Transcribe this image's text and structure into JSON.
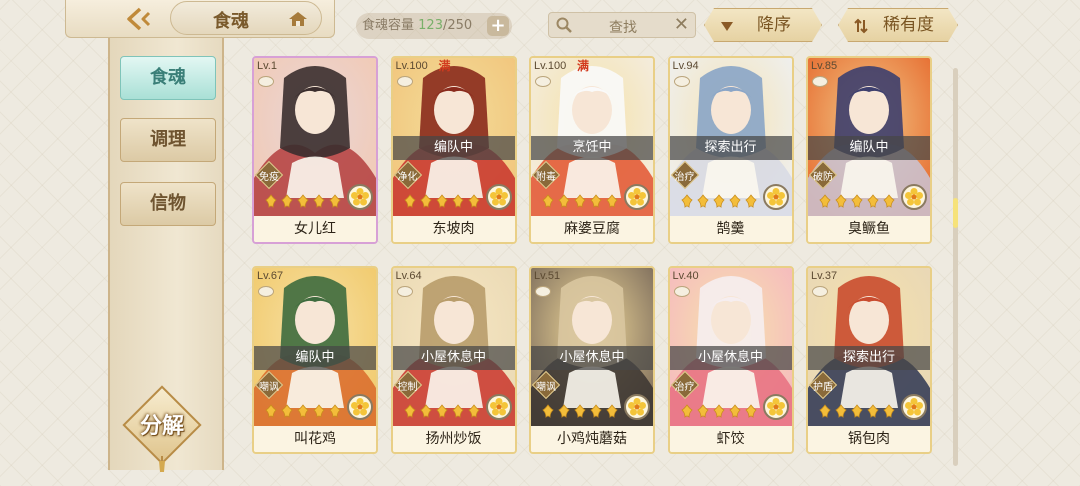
{
  "header": {
    "tab_label": "食魂",
    "capacity_label": "食魂容量",
    "capacity_current": "123",
    "capacity_sep_max": "/250",
    "search_placeholder": "查找",
    "sort_desc_label": "降序",
    "sort_rarity_label": "稀有度"
  },
  "sidebar": {
    "items": [
      {
        "label": "食魂",
        "active": true
      },
      {
        "label": "调理",
        "active": false
      },
      {
        "label": "信物",
        "active": false
      }
    ],
    "decompose_label": "分解"
  },
  "cards": [
    {
      "level": "Lv.1",
      "man": "",
      "status": "",
      "role": "免疫",
      "stars": 5,
      "name": "女儿红",
      "palette": [
        "#e9d6d6",
        "#f2c9b3",
        "#b33d3d",
        "#3a2d2d"
      ],
      "rainbow": true
    },
    {
      "level": "Lv.100",
      "man": "满",
      "status": "编队中",
      "role": "净化",
      "stars": 5,
      "name": "东坡肉",
      "palette": [
        "#f4dd9a",
        "#f1c47b",
        "#c8332b",
        "#8a2a1c"
      ],
      "rainbow": false
    },
    {
      "level": "Lv.100",
      "man": "满",
      "status": "烹饪中",
      "role": "附毒",
      "stars": 5,
      "name": "麻婆豆腐",
      "palette": [
        "#f6e2a8",
        "#f3ede2",
        "#e2542f",
        "#fafafa"
      ],
      "rainbow": false
    },
    {
      "level": "Lv.94",
      "man": "",
      "status": "探索出行",
      "role": "治疗",
      "stars": 5,
      "name": "鹄羹",
      "palette": [
        "#f5e4b6",
        "#eef0f3",
        "#d7d9e4",
        "#8aa5c7"
      ],
      "rainbow": false
    },
    {
      "level": "Lv.85",
      "man": "",
      "status": "编队中",
      "role": "破防",
      "stars": 5,
      "name": "臭鳜鱼",
      "palette": [
        "#f2c887",
        "#e66a2e",
        "#c9c4d6",
        "#3d3f6e"
      ],
      "rainbow": false
    },
    {
      "level": "Lv.67",
      "man": "",
      "status": "编队中",
      "role": "嘲讽",
      "stars": 5,
      "name": "叫花鸡",
      "palette": [
        "#f6e0a4",
        "#f1c96a",
        "#d96a2a",
        "#3e6b3e"
      ],
      "rainbow": false
    },
    {
      "level": "Lv.64",
      "man": "",
      "status": "小屋休息中",
      "role": "控制",
      "stars": 5,
      "name": "扬州炒饭",
      "palette": [
        "#f6e6c2",
        "#ead9b4",
        "#c9352c",
        "#b89c6a"
      ],
      "rainbow": false
    },
    {
      "level": "Lv.51",
      "man": "",
      "status": "小屋休息中",
      "role": "嘲讽",
      "stars": 5,
      "name": "小鸡炖蘑菇",
      "palette": [
        "#f1d99a",
        "#7a6a5a",
        "#3a3430",
        "#d9c6a0"
      ],
      "rainbow": false
    },
    {
      "level": "Lv.40",
      "man": "",
      "status": "小屋休息中",
      "role": "治疗",
      "stars": 5,
      "name": "虾饺",
      "palette": [
        "#f7e3ad",
        "#f5b8bf",
        "#e86f80",
        "#f6eef0"
      ],
      "rainbow": false
    },
    {
      "level": "Lv.37",
      "man": "",
      "status": "探索出行",
      "role": "护盾",
      "stars": 5,
      "name": "锅包肉",
      "palette": [
        "#f5e1aa",
        "#e8d7b7",
        "#2d3552",
        "#c94b2e"
      ],
      "rainbow": false
    }
  ],
  "colors": {
    "accent_gold": "#e9cf86",
    "active_tab": "#a9e0d6",
    "status_overlay": "#464646",
    "man_red": "#d23a1e"
  }
}
